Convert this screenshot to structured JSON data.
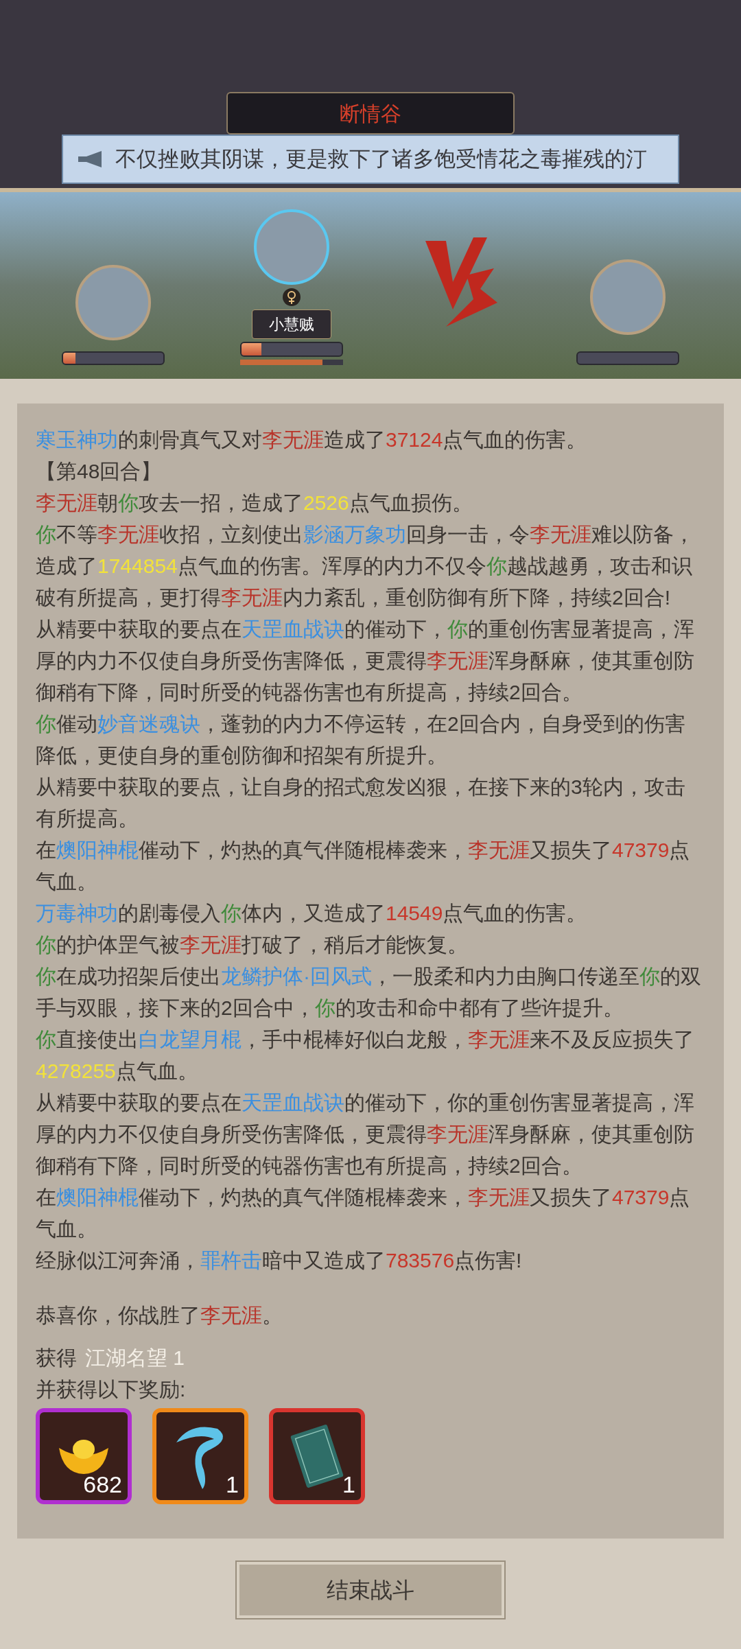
{
  "location": {
    "title": "断情谷"
  },
  "announcement": {
    "text": "不仅挫败其阴谋，更是救下了诸多饱受情花之毒摧残的汀"
  },
  "battle": {
    "player": {
      "hp": {
        "level": 0.12
      }
    },
    "companion": {
      "name": "小慧贼",
      "hp": {
        "level": 0.2
      },
      "mp": {
        "level": 0.8
      }
    }
  },
  "log": [
    [
      {
        "kind": "skill",
        "text": "寒玉神功"
      },
      {
        "kind": "plain",
        "text": "的刺骨真气又对"
      },
      {
        "kind": "enemy",
        "text": "李无涯"
      },
      {
        "kind": "plain",
        "text": "造成了"
      },
      {
        "kind": "damage",
        "text": "37124"
      },
      {
        "kind": "plain",
        "text": "点气血的伤害。"
      }
    ],
    [
      {
        "kind": "round",
        "text": "【第48回合】"
      }
    ],
    [
      {
        "kind": "enemy",
        "text": "李无涯"
      },
      {
        "kind": "plain",
        "text": "朝"
      },
      {
        "kind": "you",
        "text": "你"
      },
      {
        "kind": "plain",
        "text": "攻去一招，造成了"
      },
      {
        "kind": "crit",
        "text": "2526"
      },
      {
        "kind": "plain",
        "text": "点气血损伤。"
      }
    ],
    [
      {
        "kind": "you",
        "text": "你"
      },
      {
        "kind": "plain",
        "text": "不等"
      },
      {
        "kind": "enemy",
        "text": "李无涯"
      },
      {
        "kind": "plain",
        "text": "收招，立刻使出"
      },
      {
        "kind": "skill",
        "text": "影涵万象功"
      },
      {
        "kind": "plain",
        "text": "回身一击，令"
      },
      {
        "kind": "enemy",
        "text": "李无涯"
      },
      {
        "kind": "plain",
        "text": "难以防备，造成了"
      },
      {
        "kind": "crit",
        "text": "1744854"
      },
      {
        "kind": "plain",
        "text": "点气血的伤害。浑厚的内力不仅令"
      },
      {
        "kind": "you",
        "text": "你"
      },
      {
        "kind": "plain",
        "text": "越战越勇，攻击和识破有所提高，更打得"
      },
      {
        "kind": "enemy",
        "text": "李无涯"
      },
      {
        "kind": "plain",
        "text": "内力紊乱，重创防御有所下降，持续2回合!"
      }
    ],
    [
      {
        "kind": "plain",
        "text": "从精要中获取的要点在"
      },
      {
        "kind": "skill",
        "text": "天罡血战诀"
      },
      {
        "kind": "plain",
        "text": "的催动下，"
      },
      {
        "kind": "you",
        "text": "你"
      },
      {
        "kind": "plain",
        "text": "的重创伤害显著提高，浑厚的内力不仅使自身所受伤害降低，更震得"
      },
      {
        "kind": "enemy",
        "text": "李无涯"
      },
      {
        "kind": "plain",
        "text": "浑身酥麻，使其重创防御稍有下降，同时所受的钝器伤害也有所提高，持续2回合。"
      }
    ],
    [
      {
        "kind": "you",
        "text": "你"
      },
      {
        "kind": "plain",
        "text": "催动"
      },
      {
        "kind": "skill",
        "text": "妙音迷魂诀"
      },
      {
        "kind": "plain",
        "text": "，蓬勃的内力不停运转，在2回合内，自身受到的伤害降低，更使自身的重创防御和招架有所提升。"
      }
    ],
    [
      {
        "kind": "plain",
        "text": "从精要中获取的要点，让自身的招式愈发凶狠，在接下来的3轮内，攻击有所提高。"
      }
    ],
    [
      {
        "kind": "plain",
        "text": "在"
      },
      {
        "kind": "skill",
        "text": "燠阳神棍"
      },
      {
        "kind": "plain",
        "text": "催动下，灼热的真气伴随棍棒袭来，"
      },
      {
        "kind": "enemy",
        "text": "李无涯"
      },
      {
        "kind": "plain",
        "text": "又损失了"
      },
      {
        "kind": "damage",
        "text": "47379"
      },
      {
        "kind": "plain",
        "text": "点气血。"
      }
    ],
    [
      {
        "kind": "skill",
        "text": "万毒神功"
      },
      {
        "kind": "plain",
        "text": "的剧毒侵入"
      },
      {
        "kind": "you",
        "text": "你"
      },
      {
        "kind": "plain",
        "text": "体内，又造成了"
      },
      {
        "kind": "damage",
        "text": "14549"
      },
      {
        "kind": "plain",
        "text": "点气血的伤害。"
      }
    ],
    [
      {
        "kind": "you",
        "text": "你"
      },
      {
        "kind": "plain",
        "text": "的护体罡气被"
      },
      {
        "kind": "enemy",
        "text": "李无涯"
      },
      {
        "kind": "plain",
        "text": "打破了，稍后才能恢复。"
      }
    ],
    [
      {
        "kind": "you",
        "text": "你"
      },
      {
        "kind": "plain",
        "text": "在成功招架后使出"
      },
      {
        "kind": "skill",
        "text": "龙鳞护体·回风式"
      },
      {
        "kind": "plain",
        "text": "，一股柔和内力由胸口传递至"
      },
      {
        "kind": "you",
        "text": "你"
      },
      {
        "kind": "plain",
        "text": "的双手与双眼，接下来的2回合中，"
      },
      {
        "kind": "you",
        "text": "你"
      },
      {
        "kind": "plain",
        "text": "的攻击和命中都有了些许提升。"
      }
    ],
    [
      {
        "kind": "you",
        "text": "你"
      },
      {
        "kind": "plain",
        "text": "直接使出"
      },
      {
        "kind": "skill",
        "text": "白龙望月棍"
      },
      {
        "kind": "plain",
        "text": "，手中棍棒好似白龙般，"
      },
      {
        "kind": "enemy",
        "text": "李无涯"
      },
      {
        "kind": "plain",
        "text": "来不及反应损失了"
      },
      {
        "kind": "crit",
        "text": "4278255"
      },
      {
        "kind": "plain",
        "text": "点气血。"
      }
    ],
    [
      {
        "kind": "plain",
        "text": "从精要中获取的要点在"
      },
      {
        "kind": "skill",
        "text": "天罡血战诀"
      },
      {
        "kind": "plain",
        "text": "的催动下，你的重创伤害显著提高，浑厚的内力不仅使自身所受伤害降低，更震得"
      },
      {
        "kind": "enemy",
        "text": "李无涯"
      },
      {
        "kind": "plain",
        "text": "浑身酥麻，使其重创防御稍有下降，同时所受的钝器伤害也有所提高，持续2回合。"
      }
    ],
    [
      {
        "kind": "plain",
        "text": "在"
      },
      {
        "kind": "skill",
        "text": "燠阳神棍"
      },
      {
        "kind": "plain",
        "text": "催动下，灼热的真气伴随棍棒袭来，"
      },
      {
        "kind": "enemy",
        "text": "李无涯"
      },
      {
        "kind": "plain",
        "text": "又损失了"
      },
      {
        "kind": "damage",
        "text": "47379"
      },
      {
        "kind": "plain",
        "text": "点气血。"
      }
    ],
    [
      {
        "kind": "plain",
        "text": "经脉似江河奔涌，"
      },
      {
        "kind": "skill",
        "text": "罪杵击"
      },
      {
        "kind": "plain",
        "text": "暗中又造成了"
      },
      {
        "kind": "damage",
        "text": "783576"
      },
      {
        "kind": "plain",
        "text": "点伤害!"
      }
    ]
  ],
  "result": [
    {
      "kind": "plain",
      "text": "恭喜你，你战胜了"
    },
    {
      "kind": "enemy",
      "text": "李无涯"
    },
    {
      "kind": "plain",
      "text": "。"
    }
  ],
  "gain": {
    "label": "获得",
    "value": "江湖名望 1"
  },
  "rewards_label": "并获得以下奖励:",
  "rewards": [
    {
      "kind": "ingot",
      "count": "682",
      "color": "#b02fd0"
    },
    {
      "kind": "swirl",
      "count": "1",
      "color": "#f08a1a"
    },
    {
      "kind": "book",
      "count": "1",
      "color": "#d8352f"
    }
  ],
  "end_button": "结束战斗"
}
